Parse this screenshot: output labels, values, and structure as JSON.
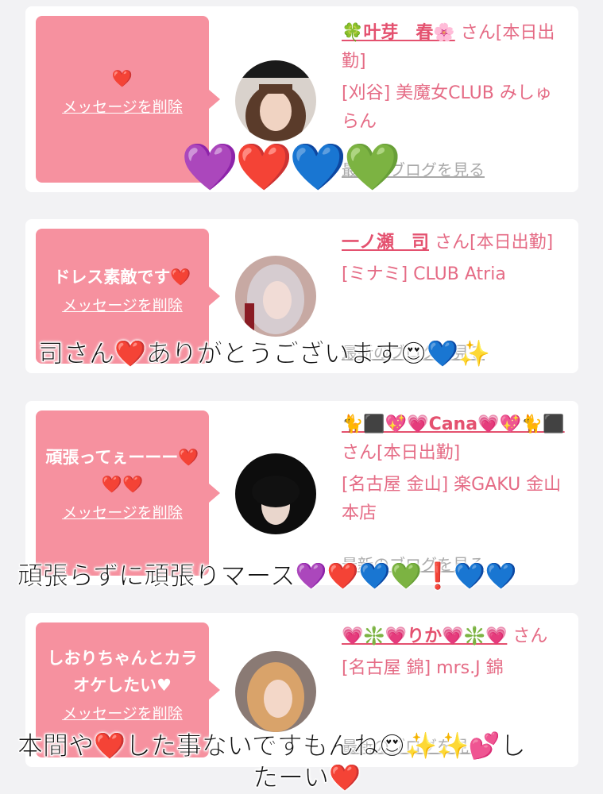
{
  "cards": [
    {
      "message": "❤️",
      "delete_label": "メッセージを削除",
      "name": "🍀叶芽　春🌸",
      "suffix": "さん[本日出勤]",
      "shop": "[刈谷] 美魔女CLUB みしゅらん",
      "blog_label": "最新のブログを見る"
    },
    {
      "message": "ドレス素敵です❤️",
      "delete_label": "メッセージを削除",
      "name": "一ノ瀬　司",
      "suffix": "さん[本日出勤]",
      "shop": "[ミナミ] CLUB Atria",
      "blog_label": "最新のブログを見る"
    },
    {
      "message": "頑張ってぇーーー❤️❤️❤️",
      "delete_label": "メッセージを削除",
      "name": "🐈⬛💖💗Cana💗💖🐈⬛",
      "suffix": "さん[本日出勤]",
      "shop": "[名古屋 金山] 楽GAKU 金山本店",
      "blog_label": "最新のブログを見る"
    },
    {
      "message": "しおりちゃんとカラオケしたい♥",
      "delete_label": "メッセージを削除",
      "name": "💗❇️💗りか💗❇️💗",
      "suffix": "さん",
      "shop": "[名古屋 錦] mrs.J 錦",
      "blog_label": "最新のブログを見る"
    }
  ],
  "overlays": {
    "hearts_row": "💜❤️💙💚",
    "line1": "司さん❤️ありがとうございます😍💙✨",
    "line2": "頑張らずに頑張りマース💜❤️💙💚❗️💙💙",
    "line3a": "本間や❤️した事ないですもんね😍✨✨💕し",
    "line3b": "たーい❤️"
  },
  "colors": {
    "bubble": "#f6919f",
    "name": "#e4516f",
    "text": "#e56b85",
    "background": "#f2f2f4"
  }
}
